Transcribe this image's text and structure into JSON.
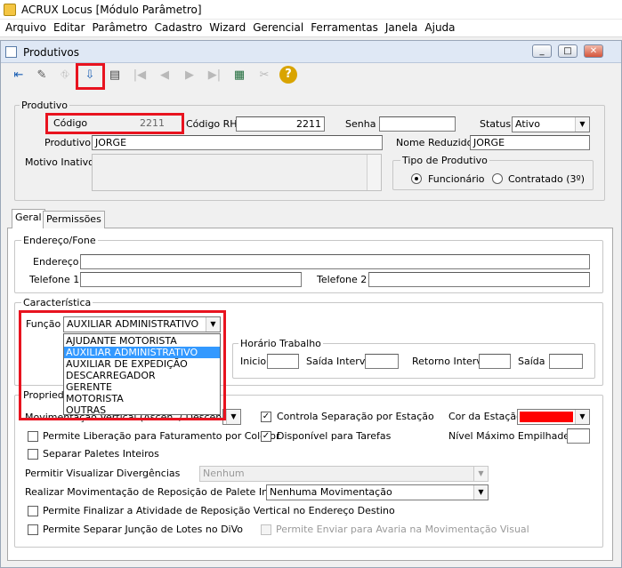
{
  "window": {
    "title": "ACRUX Locus [Módulo Parâmetro]"
  },
  "menu": [
    "Arquivo",
    "Editar",
    "Parâmetro",
    "Cadastro",
    "Wizard",
    "Gerencial",
    "Ferramentas",
    "Janela",
    "Ajuda"
  ],
  "child": {
    "title": "Produtivos",
    "min": "_",
    "max": "□",
    "close": "✕"
  },
  "toolbar": {
    "icons": [
      "exit-icon",
      "eraser-icon",
      "tree-icon",
      "import-icon",
      "print-icon",
      "first-icon",
      "prev-icon",
      "next-icon",
      "last-icon",
      "grid-icon",
      "edit-icon",
      "help-icon"
    ],
    "glyphs": [
      "⇤",
      "✎",
      "⛗",
      "⇩",
      "▤",
      "|◀",
      "◀",
      "▶",
      "▶|",
      "▦",
      "✂",
      "?"
    ]
  },
  "produtivo": {
    "group": "Produtivo",
    "codigo_label": "Código",
    "codigo": "2211",
    "codigo_rh_label": "Código RH",
    "codigo_rh": "2211",
    "senha_label": "Senha",
    "senha": "",
    "status_label": "Status",
    "status": "Ativo",
    "produtivo_label": "Produtivo",
    "produtivo": "JORGE",
    "nome_reduzido_label": "Nome Reduzido",
    "nome_reduzido": "JORGE",
    "motivo_label": "Motivo Inativo",
    "motivo": "",
    "tipo_group": "Tipo de Produtivo",
    "tipo_func": "Funcionário",
    "tipo_contr": "Contratado (3º)"
  },
  "tabs": [
    "Geral",
    "Permissões"
  ],
  "endereco": {
    "group": "Endereço/Fone",
    "endereco_label": "Endereço",
    "tel1_label": "Telefone 1",
    "tel2_label": "Telefone 2"
  },
  "caracteristica": {
    "group": "Característica",
    "funcao_label": "Função",
    "funcao": "AUXILIAR ADMINISTRATIVO",
    "options": [
      "AJUDANTE MOTORISTA",
      "AUXILIAR ADMINISTRATIVO",
      "AUXILIAR DE EXPEDIÇÃO",
      "DESCARREGADOR",
      "GERENTE",
      "MOTORISTA",
      "OUTRAS"
    ],
    "horario_group": "Horário Trabalho",
    "inicio": "Inicio",
    "saida_interv": "Saída Interv.",
    "retorno_interv": "Retorno Interv.",
    "saida": "Saída"
  },
  "propriedades": {
    "group": "Propriedades",
    "movimentacao_label": "Movimentação Vertical (Ascen. / Descendente)",
    "controla_sep": "Controla Separação por Estação",
    "cor_estacao": "Cor da Estação",
    "cor_value": "#ff0000",
    "perm_liberacao": "Permite Liberação para Faturamento por Coletor",
    "disponivel": "Disponível para Tarefas",
    "nivel_max": "Nível Máximo Empilhadeira",
    "separar_paletes": "Separar Paletes Inteiros",
    "perm_visualizar": "Permitir Visualizar Divergências",
    "perm_visualizar_val": "Nenhum",
    "realizar_mov": "Realizar Movimentação de Reposição de Palete Inteiro",
    "realizar_mov_val": "Nenhuma Movimentação",
    "perm_finalizar": "Permite Finalizar a Atividade de Reposição Vertical no Endereço Destino",
    "perm_separar_juncao": "Permite Separar Junção de Lotes no DiVo",
    "perm_avaria": "Permite Enviar para Avaria na Movimentação Visual"
  }
}
